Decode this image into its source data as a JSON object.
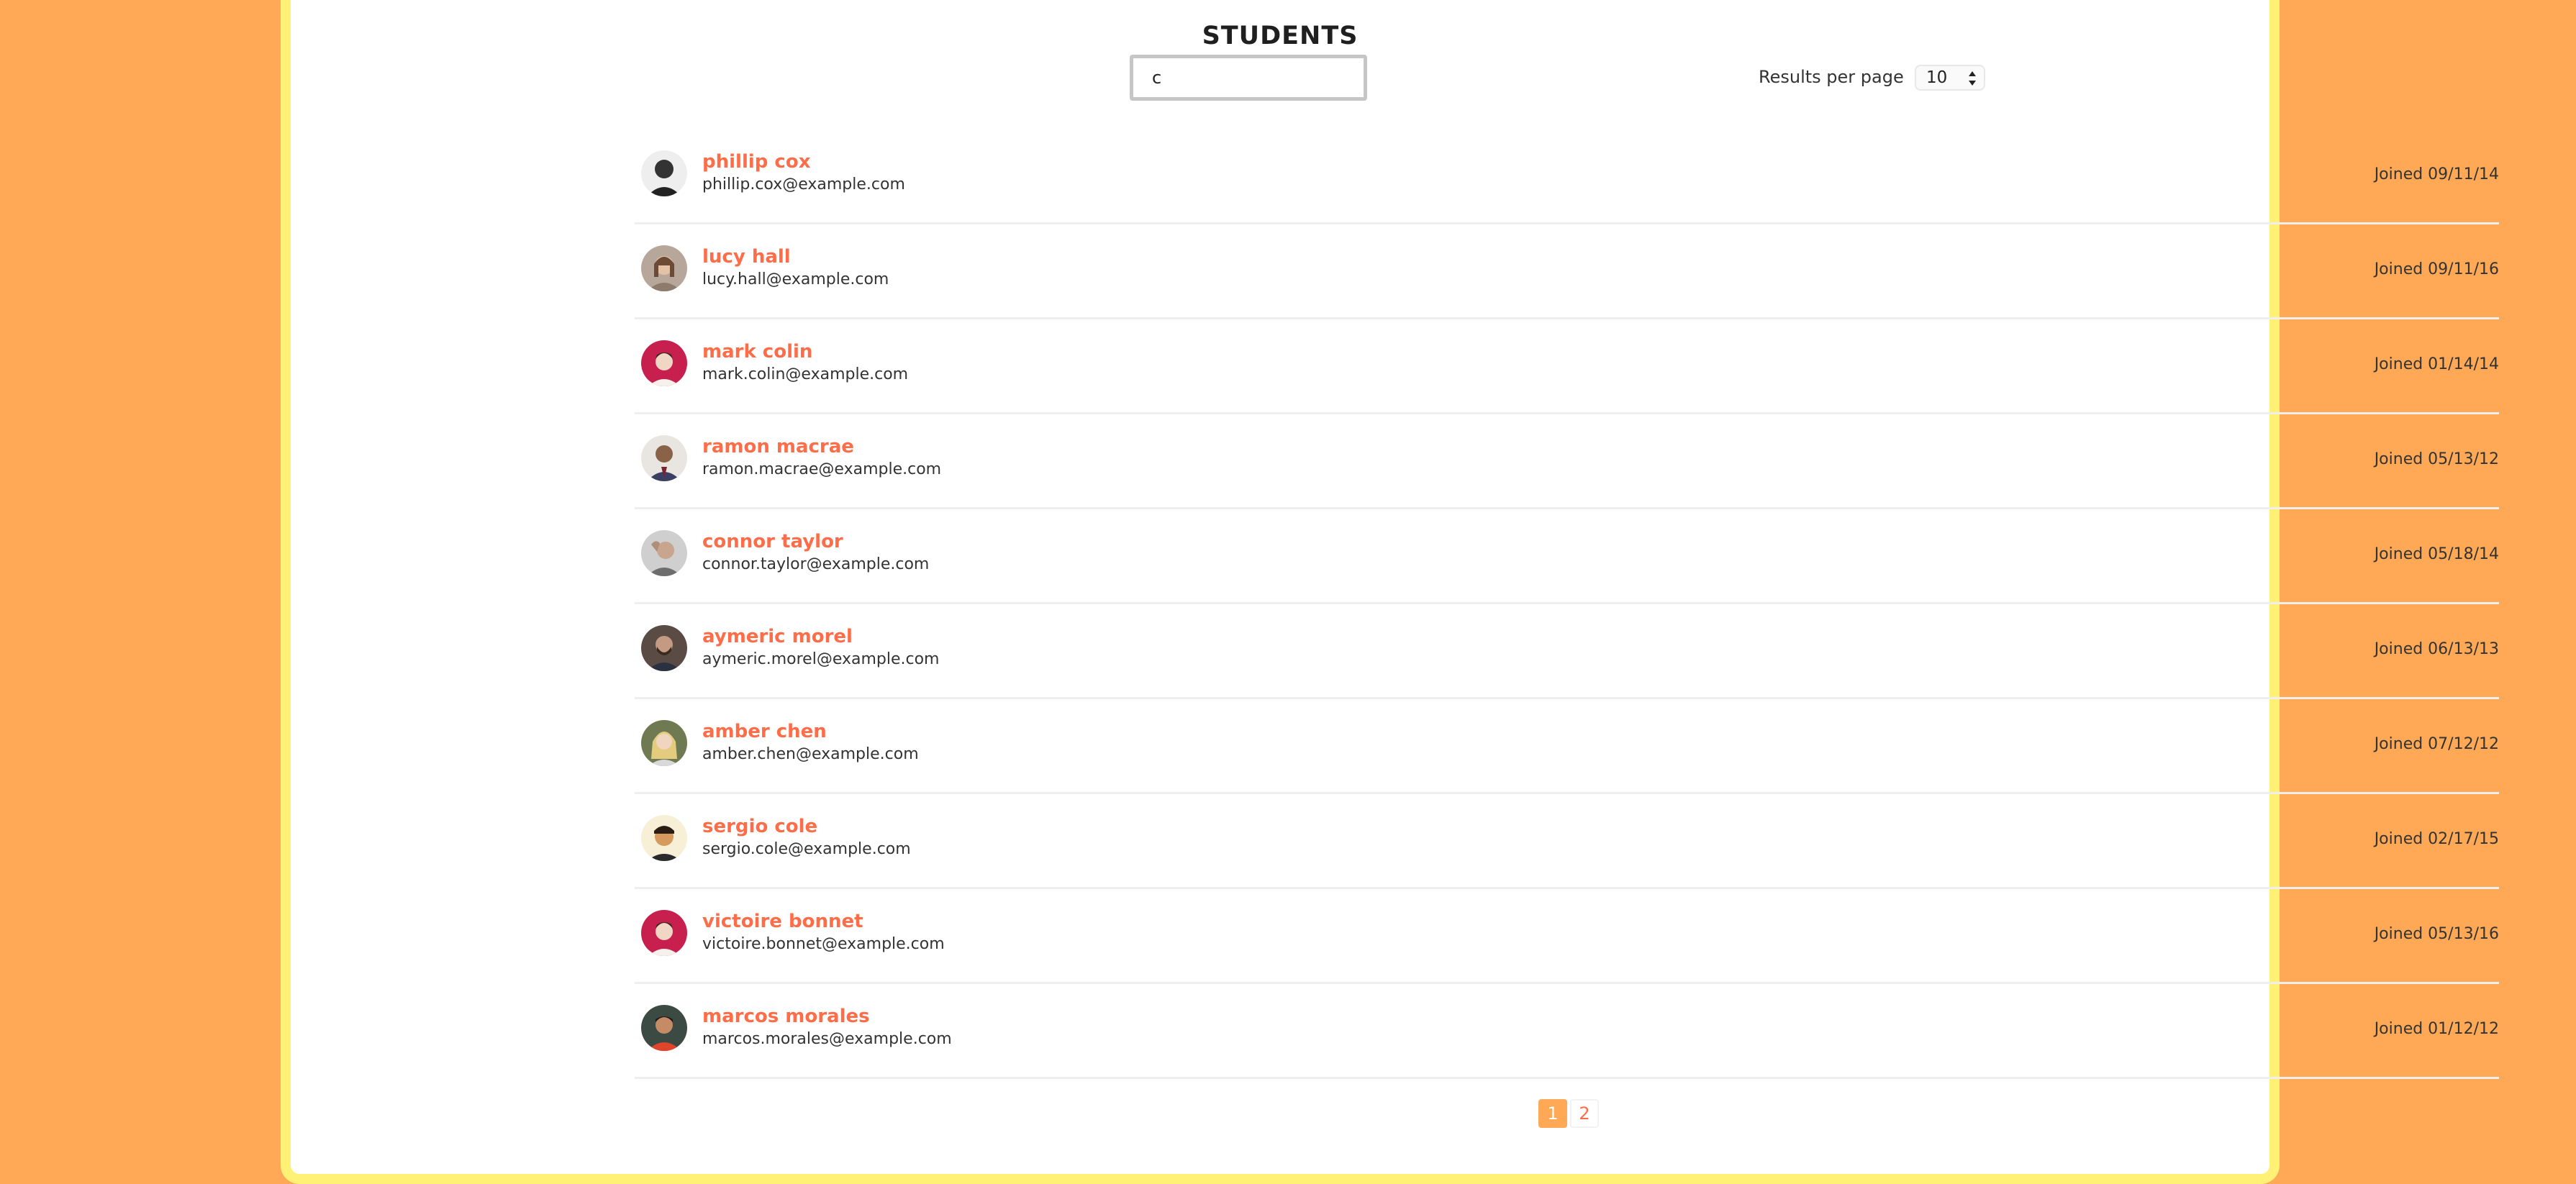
{
  "page": {
    "title": "STUDENTS"
  },
  "search": {
    "value": "c"
  },
  "results_per_page": {
    "label": "Results per page",
    "value": "10"
  },
  "students": [
    {
      "name": "phillip cox",
      "email": "phillip.cox@example.com",
      "joined": "Joined 09/11/14"
    },
    {
      "name": "lucy hall",
      "email": "lucy.hall@example.com",
      "joined": "Joined 09/11/16"
    },
    {
      "name": "mark colin",
      "email": "mark.colin@example.com",
      "joined": "Joined 01/14/14"
    },
    {
      "name": "ramon macrae",
      "email": "ramon.macrae@example.com",
      "joined": "Joined 05/13/12"
    },
    {
      "name": "connor taylor",
      "email": "connor.taylor@example.com",
      "joined": "Joined 05/18/14"
    },
    {
      "name": "aymeric morel",
      "email": "aymeric.morel@example.com",
      "joined": "Joined 06/13/13"
    },
    {
      "name": "amber chen",
      "email": "amber.chen@example.com",
      "joined": "Joined 07/12/12"
    },
    {
      "name": "sergio cole",
      "email": "sergio.cole@example.com",
      "joined": "Joined 02/17/15"
    },
    {
      "name": "victoire bonnet",
      "email": "victoire.bonnet@example.com",
      "joined": "Joined 05/13/16"
    },
    {
      "name": "marcos morales",
      "email": "marcos.morales@example.com",
      "joined": "Joined 01/12/12"
    }
  ],
  "pagination": {
    "pages": [
      "1",
      "2"
    ],
    "current": "1"
  },
  "colors": {
    "accent": "#ff6d48",
    "page_bg": "#ffa957",
    "frame_border": "#fff176"
  }
}
